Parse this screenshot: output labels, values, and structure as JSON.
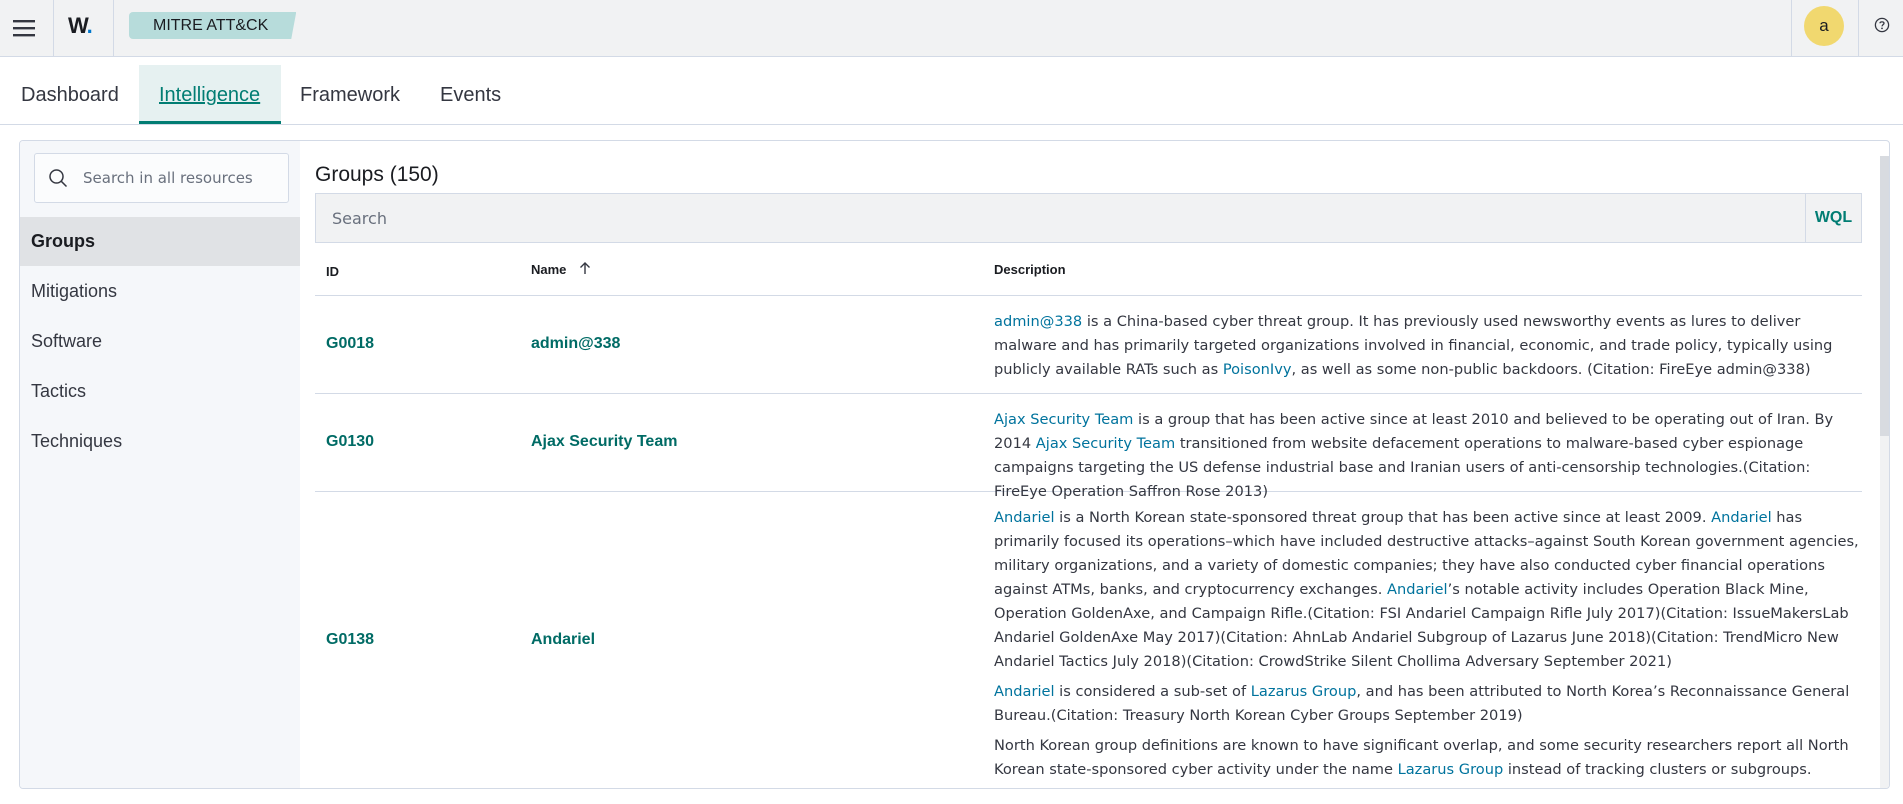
{
  "header": {
    "logo_text": "W",
    "logo_dot": ".",
    "breadcrumb": "MITRE ATT&CK",
    "avatar_initial": "a",
    "icons": [
      "menu-icon",
      "help-icon"
    ]
  },
  "tabs": [
    {
      "label": "Dashboard",
      "active": false
    },
    {
      "label": "Intelligence",
      "active": true
    },
    {
      "label": "Framework",
      "active": false
    },
    {
      "label": "Events",
      "active": false
    }
  ],
  "sidebar": {
    "search_placeholder": "Search in all resources",
    "items": [
      {
        "label": "Groups",
        "active": true
      },
      {
        "label": "Mitigations",
        "active": false
      },
      {
        "label": "Software",
        "active": false
      },
      {
        "label": "Tactics",
        "active": false
      },
      {
        "label": "Techniques",
        "active": false
      }
    ]
  },
  "main": {
    "title": "Groups (150)",
    "search_placeholder": "Search",
    "wql_label": "WQL",
    "columns": {
      "id": "ID",
      "name": "Name",
      "description": "Description"
    },
    "rows": [
      {
        "id": "G0018",
        "name": "admin@338",
        "desc": {
          "a1": "admin@338",
          "t1": " is a China-based cyber threat group. It has previously used newsworthy events as lures to deliver malware and has primarily targeted organizations involved in financial, economic, and trade policy, typically using publicly available RATs such as ",
          "a2": "PoisonIvy",
          "t2": ", as well as some non-public backdoors. (Citation: FireEye admin@338)"
        }
      },
      {
        "id": "G0130",
        "name": "Ajax Security Team",
        "desc": {
          "a1": "Ajax Security Team",
          "t1": " is a group that has been active since at least 2010 and believed to be operating out of Iran. By 2014 ",
          "a2": "Ajax Security Team",
          "t2": " transitioned from website defacement operations to malware-based cyber espionage campaigns targeting the US defense industrial base and Iranian users of anti-censorship technologies.(Citation: FireEye Operation Saffron Rose 2013)"
        }
      },
      {
        "id": "G0138",
        "name": "Andariel",
        "desc": {
          "p1_a1": "Andariel",
          "p1_t1": " is a North Korean state-sponsored threat group that has been active since at least 2009. ",
          "p1_a2": "Andariel",
          "p1_t2": " has primarily focused its operations–which have included destructive attacks–against South Korean government agencies, military organizations, and a variety of domestic companies; they have also conducted cyber financial operations against ATMs, banks, and cryptocurrency exchanges. ",
          "p1_a3": "Andariel",
          "p1_t3": "’s notable activity includes Operation Black Mine, Operation GoldenAxe, and Campaign Rifle.(Citation: FSI Andariel Campaign Rifle July 2017)(Citation: IssueMakersLab Andariel GoldenAxe May 2017)(Citation: AhnLab Andariel Subgroup of Lazarus June 2018)(Citation: TrendMicro New Andariel Tactics July 2018)(Citation: CrowdStrike Silent Chollima Adversary September 2021)",
          "p2_a1": "Andariel",
          "p2_t1": " is considered a sub-set of ",
          "p2_a2": "Lazarus Group",
          "p2_t2": ", and has been attributed to North Korea’s Reconnaissance General Bureau.(Citation: Treasury North Korean Cyber Groups September 2019)",
          "p3_t1": "North Korean group definitions are known to have significant overlap, and some security researchers report all North Korean state-sponsored cyber activity under the name ",
          "p3_a1": "Lazarus Group",
          "p3_t2": " instead of tracking clusters or subgroups."
        }
      }
    ]
  },
  "colors": {
    "accent": "#017d73",
    "link": "#00739d",
    "breadcrumb_bg": "#b7dcdb",
    "avatar_bg": "#f1d86f"
  }
}
